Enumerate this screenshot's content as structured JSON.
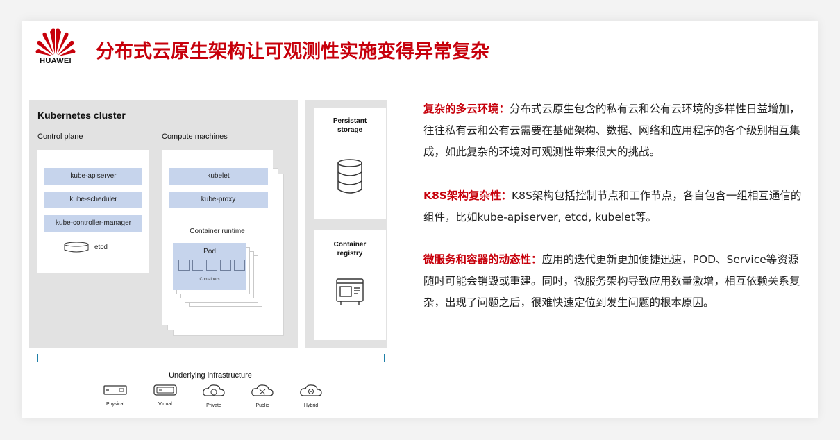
{
  "brand": {
    "name": "HUAWEI",
    "color": "#c7000b"
  },
  "title": "分布式云原生架构让可观测性实施变得异常复杂",
  "diagram": {
    "cluster_title": "Kubernetes cluster",
    "control_plane": {
      "label": "Control plane",
      "components": [
        "kube-apiserver",
        "kube-scheduler",
        "kube-controller-manager"
      ],
      "etcd": "etcd"
    },
    "compute": {
      "label": "Compute machines",
      "components": [
        "kubelet",
        "kube-proxy"
      ],
      "runtime_label": "Container runtime",
      "pod_label": "Pod",
      "containers_label": "Containers"
    },
    "storage": {
      "line1": "Persistant",
      "line2": "storage"
    },
    "registry": {
      "line1": "Container",
      "line2": "registry"
    },
    "infrastructure": {
      "label": "Underlying infrastructure",
      "items": [
        "Physical",
        "Virtual",
        "Private",
        "Public",
        "Hybrid"
      ]
    }
  },
  "points": [
    {
      "lead": "复杂的多云环境：",
      "body": "分布式云原生包含的私有云和公有云环境的多样性日益增加，往往私有云和公有云需要在基础架构、数据、网络和应用程序的各个级别相互集成，如此复杂的环境对可观测性带来很大的挑战。"
    },
    {
      "lead": "K8S架构复杂性：",
      "body": "K8S架构包括控制节点和工作节点，各自包含一组相互通信的组件，比如kube-apiserver, etcd, kubelet等。"
    },
    {
      "lead": "微服务和容器的动态性：",
      "body": "应用的迭代更新更加便捷迅速，POD、Service等资源随时可能会销毁或重建。同时，微服务架构导致应用数量激增，相互依赖关系复杂，出现了问题之后，很难快速定位到发生问题的根本原因。"
    }
  ]
}
